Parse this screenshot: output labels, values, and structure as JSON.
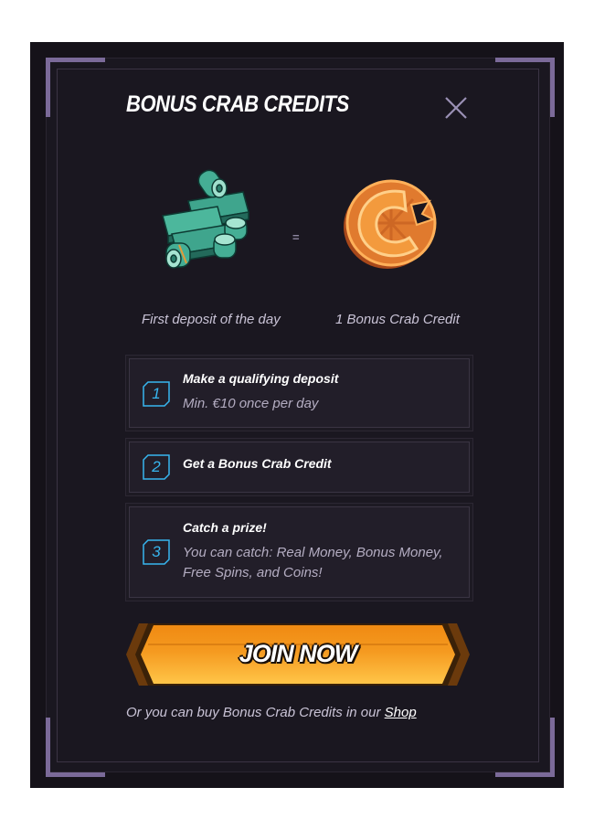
{
  "dialog": {
    "title": "BONUS CRAB CREDITS",
    "close_icon": "close-icon"
  },
  "rewards": {
    "left_caption": "First deposit of the day",
    "equals": "=",
    "right_caption": "1 Bonus Crab Credit",
    "left_icon": "cash-stack-icon",
    "right_icon": "crab-coin-icon"
  },
  "steps": [
    {
      "number": "1",
      "title": "Make a qualifying deposit",
      "desc": "Min. €10 once per day"
    },
    {
      "number": "2",
      "title": "Get a Bonus Crab Credit",
      "desc": ""
    },
    {
      "number": "3",
      "title": "Catch a prize!",
      "desc": "You can catch: Real Money, Bonus Money, Free Spins, and Coins!"
    }
  ],
  "cta": {
    "label": "JOIN NOW"
  },
  "footer": {
    "text": "Or you can buy Bonus Crab Credits in our ",
    "link": "Shop"
  },
  "colors": {
    "accent_orange": "#f5a623",
    "step_number_blue": "#37b6ef",
    "frame_purple": "#7b6a99",
    "panel_bg": "#1a1720"
  }
}
